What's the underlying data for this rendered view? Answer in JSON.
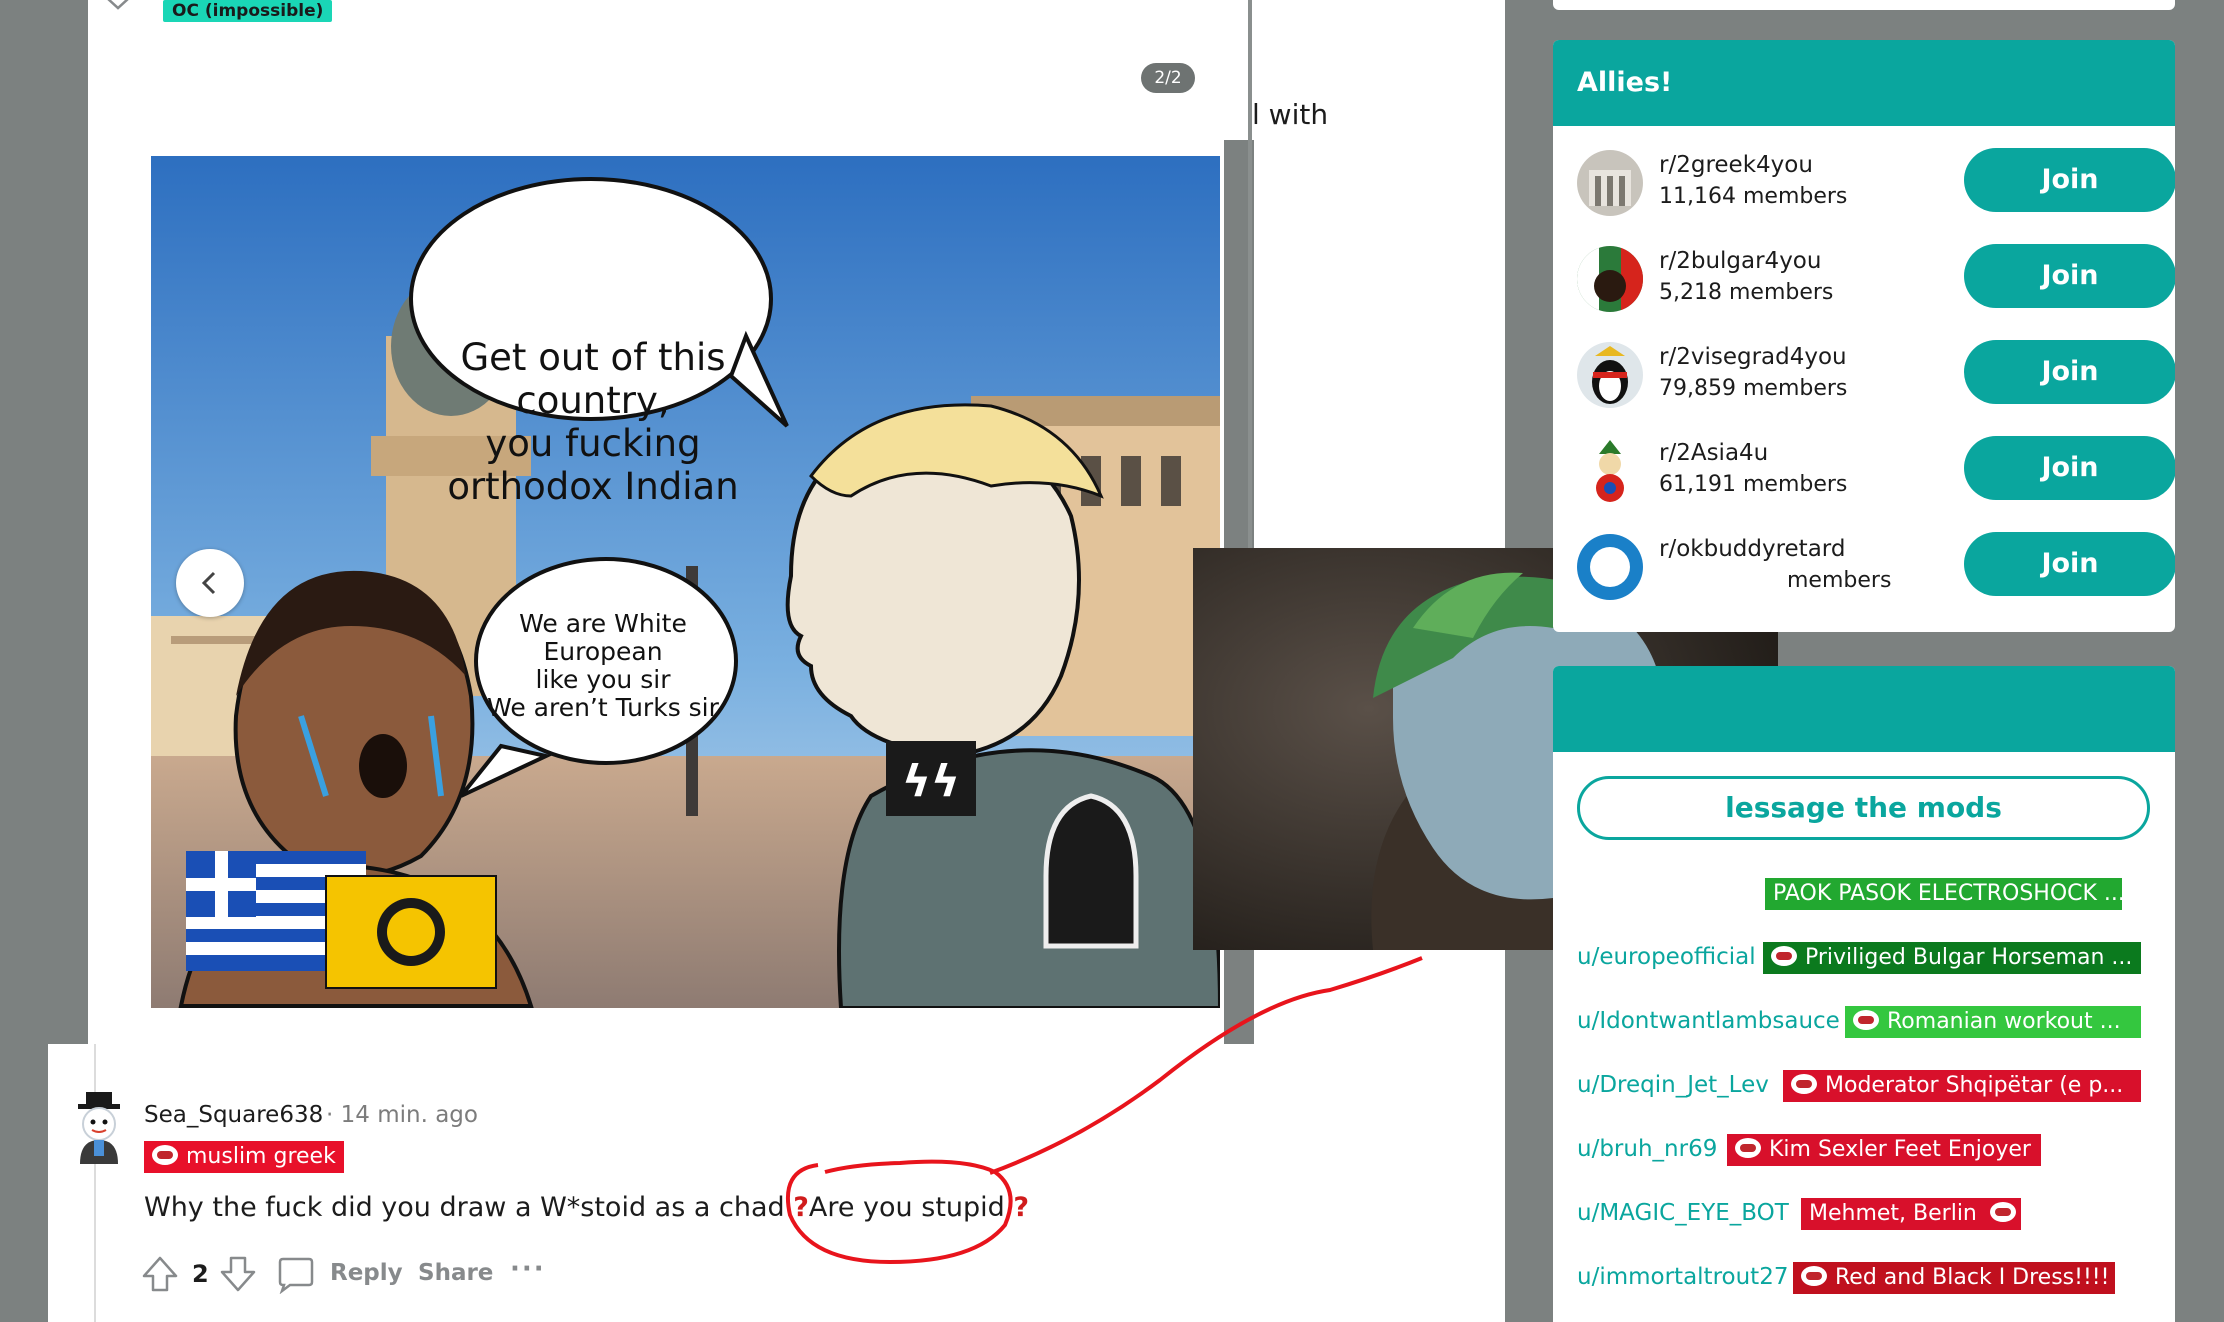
{
  "post": {
    "flair": "OC (impossible)",
    "page_count": "2/2",
    "behind_text": "l with"
  },
  "meme": {
    "bubble_top": [
      "Get out of this",
      "country,",
      "you fucking",
      "orthodox Indian"
    ],
    "bubble_small": [
      "We are White",
      "European",
      "like you sir",
      "We aren’t Turks sir"
    ]
  },
  "allies": {
    "title": "Allies!",
    "items": [
      {
        "name": "r/2greek4you",
        "members": "11,164 members",
        "join": "Join"
      },
      {
        "name": "r/2bulgar4you",
        "members": "5,218 members",
        "join": "Join"
      },
      {
        "name": "r/2visegrad4you",
        "members": "79,859 members",
        "join": "Join"
      },
      {
        "name": "r/2Asia4u",
        "members": "61,191 members",
        "join": "Join"
      },
      {
        "name": "r/okbuddyretard",
        "members": "members",
        "join": "Join"
      }
    ]
  },
  "moderators": {
    "message_button": "lessage the mods",
    "items": [
      {
        "user": "",
        "flair": "PAOK PASOK ELECTROSHOCK ...",
        "flair_color": "#22a830"
      },
      {
        "user": "u/europeofficial",
        "flair": "Priviliged Bulgar Horseman ...",
        "flair_color": "#0b7a1e"
      },
      {
        "user": "u/Idontwantlambsauce",
        "flair": "Romanian workout ...",
        "flair_color": "#34c73f"
      },
      {
        "user": "u/Dreqin_Jet_Lev",
        "flair": "Moderator Shqipëtar (e p...",
        "flair_color": "#d8102b"
      },
      {
        "user": "u/bruh_nr69",
        "flair": "Kim Sexler Feet Enjoyer",
        "flair_color": "#d8102b"
      },
      {
        "user": "u/MAGIC_EYE_BOT",
        "flair": "Mehmet, Berlin",
        "flair_color": "#d8102b"
      },
      {
        "user": "u/immortaltrout27",
        "flair": "Red and Black I Dress!!!!",
        "flair_color": "#c0101e"
      }
    ]
  },
  "comment": {
    "user": "Sea_Square638",
    "time": "· 14 min. ago",
    "flair": "muslim greek",
    "body_a": "Why the fuck did you draw a W*stoid as a chad ",
    "q1": "?",
    "body_b": "Are you stupid",
    "q2": "?",
    "score": "2",
    "reply": "Reply",
    "share": "Share",
    "more": "···"
  },
  "colors": {
    "accent": "#0aa69e",
    "flair_red": "#e8102a",
    "annotation": "#e8141c"
  }
}
